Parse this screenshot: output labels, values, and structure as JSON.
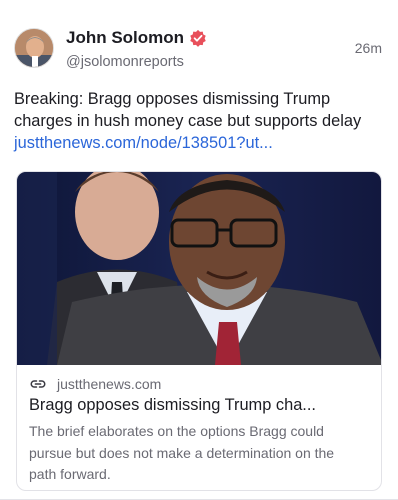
{
  "post": {
    "author_name": "John Solomon",
    "author_handle": "@jsolomonreports",
    "timestamp": "26m",
    "text": "Breaking: Bragg opposes dismissing Trump charges in hush money case but supports delay ",
    "link_text": "justthenews.com/node/138501?ut...",
    "icons": {
      "verified": "verified-badge-icon",
      "link": "link-icon"
    },
    "colors": {
      "link": "#2b66d9",
      "verified": "#e8505b"
    }
  },
  "embed": {
    "domain": "justthenews.com",
    "title": "Bragg opposes dismissing Trump cha...",
    "description": "The brief elaborates on the options Bragg could pursue but does not make a determination on the path forward."
  }
}
